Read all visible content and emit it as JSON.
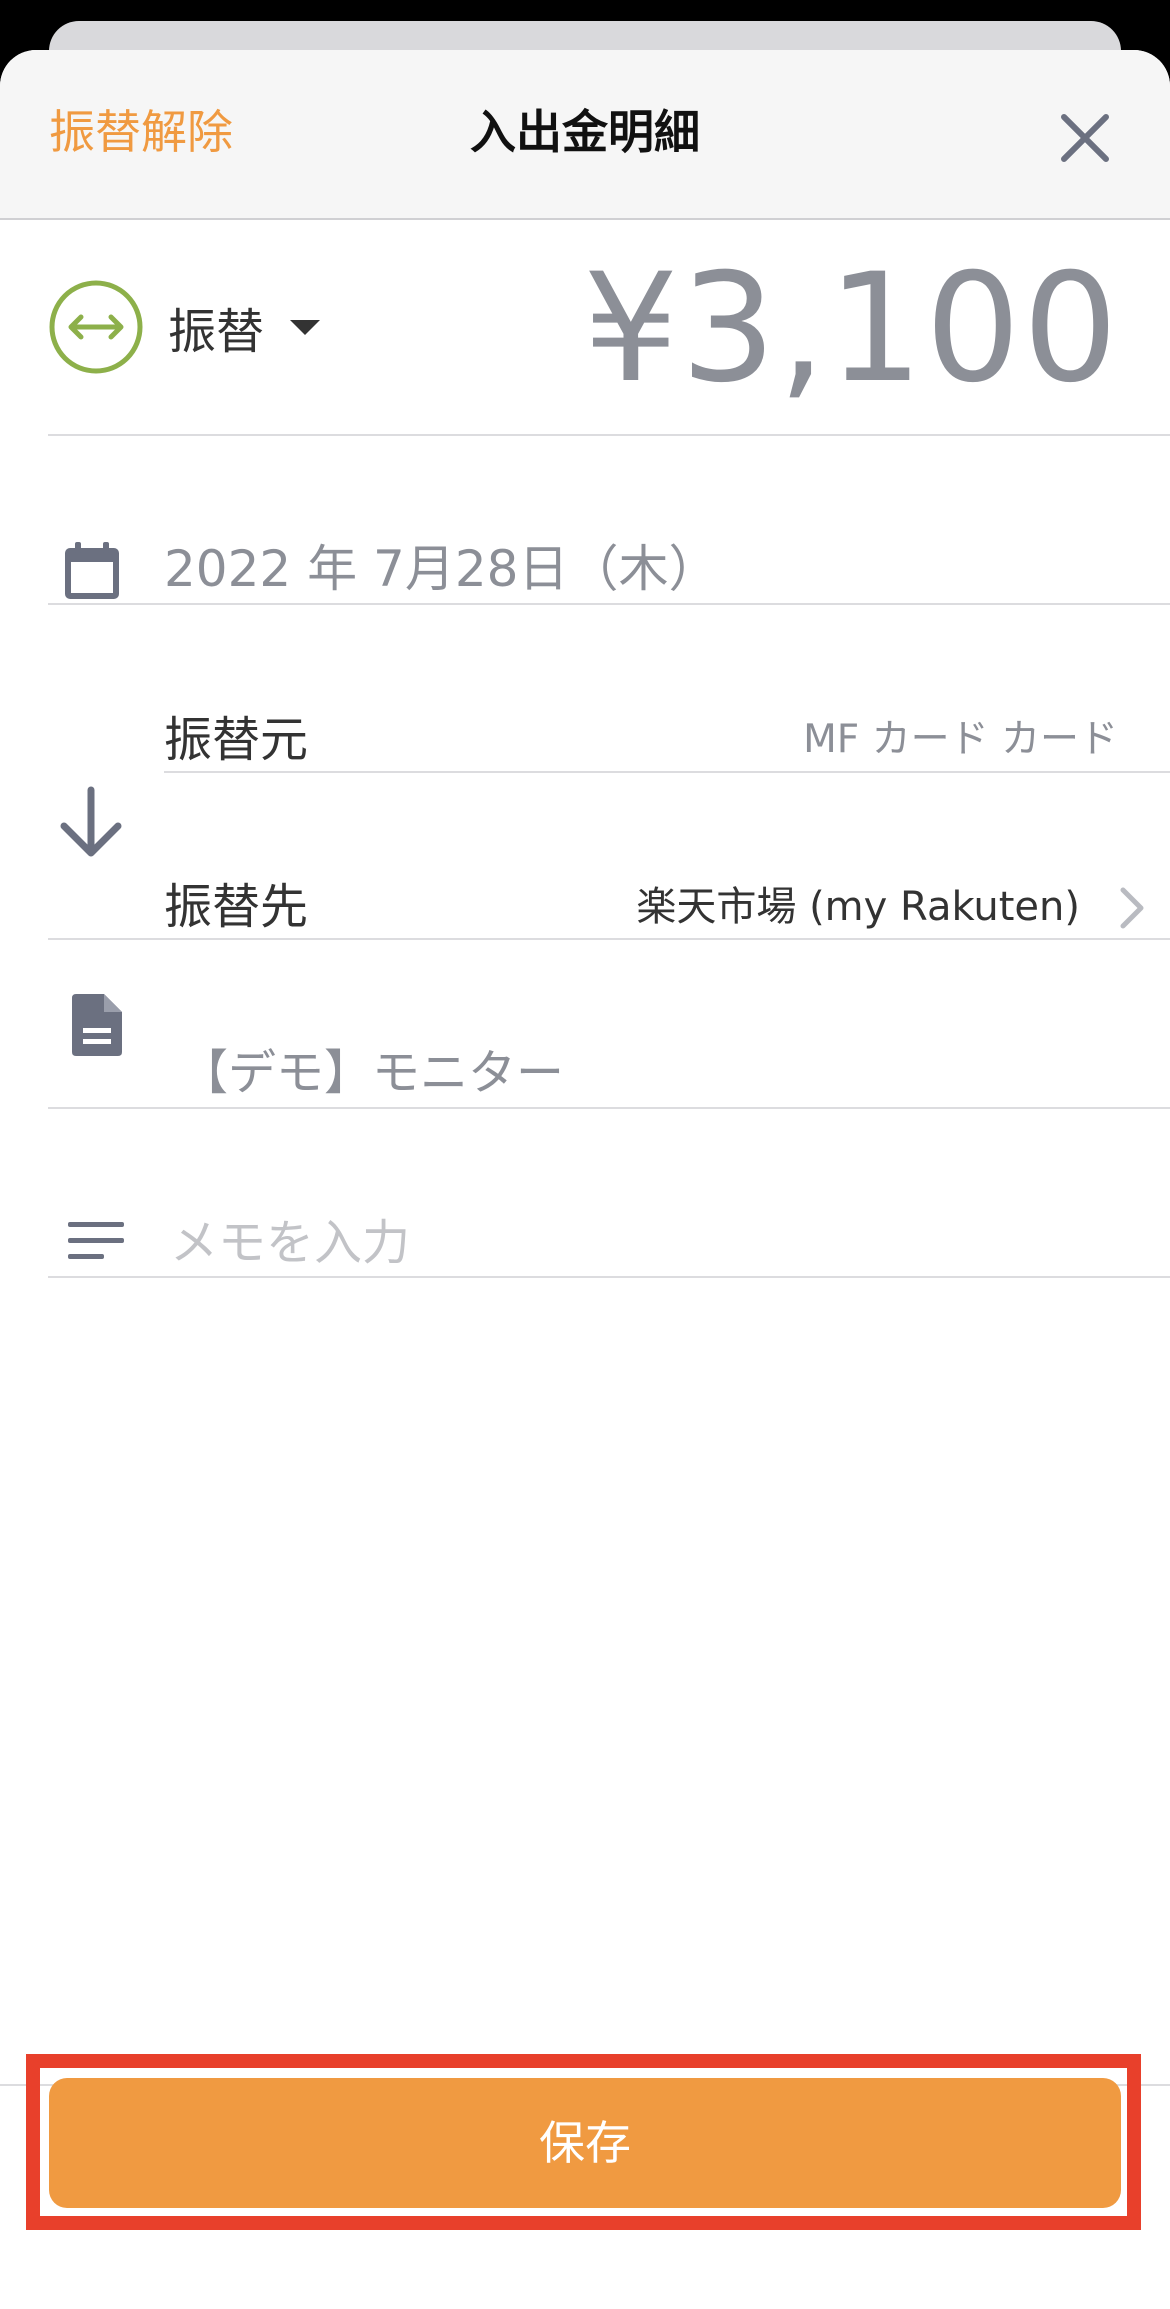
{
  "header": {
    "unlink_label": "振替解除",
    "title": "入出金明細"
  },
  "transaction": {
    "type_label": "振替",
    "amount": "¥3,100",
    "date": "2022 年 7月28日（木）",
    "from_label": "振替元",
    "from_value": "MF カード カード",
    "to_label": "振替先",
    "to_value": "楽天市場 (my Rakuten)",
    "content": "【デモ】モニター",
    "memo_value": "",
    "memo_placeholder": "メモを入力"
  },
  "footer": {
    "save_label": "保存"
  },
  "colors": {
    "accent": "#f09a41",
    "transfer_icon": "#8db04a",
    "amount_gray": "#8c8f97",
    "highlight": "#e8402b",
    "icon_gray": "#6b7080"
  },
  "icons": {
    "close": "close-icon",
    "type": "transfer-icon",
    "date": "calendar-icon",
    "direction": "arrow-down-icon",
    "content": "document-icon",
    "memo": "notes-icon",
    "chevron": "chevron-right-icon"
  }
}
